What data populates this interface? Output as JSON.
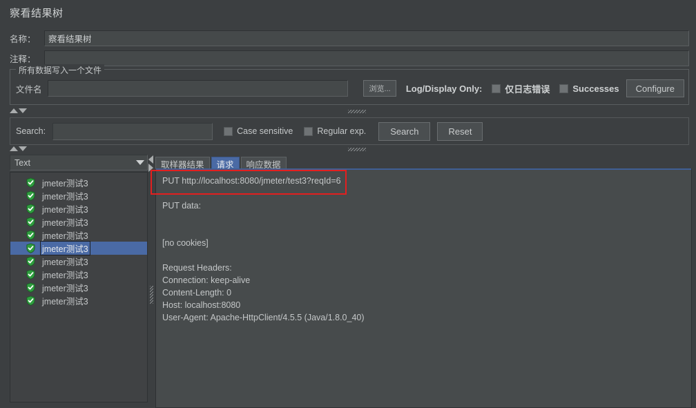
{
  "window": {
    "title": "察看结果树"
  },
  "form": {
    "name_label": "名称：",
    "name_value": "察看结果树",
    "comment_label": "注释：",
    "comment_value": ""
  },
  "file_group": {
    "legend": "所有数据写入一个文件",
    "filename_label": "文件名",
    "filename_value": "",
    "browse_label": "浏览...",
    "log_display_only_label": "Log/Display Only:",
    "errors_only_label": "仅日志错误",
    "errors_only_checked": false,
    "successes_label": "Successes",
    "successes_checked": false,
    "configure_label": "Configure"
  },
  "search": {
    "label": "Search:",
    "value": "",
    "case_sensitive_label": "Case sensitive",
    "case_sensitive_checked": false,
    "regular_exp_label": "Regular exp.",
    "regular_exp_checked": false,
    "search_button": "Search",
    "reset_button": "Reset"
  },
  "results": {
    "renderer_selected": "Text",
    "tree_items": [
      {
        "label": "jmeter测试3",
        "status": "success",
        "selected": false
      },
      {
        "label": "jmeter测试3",
        "status": "success",
        "selected": false
      },
      {
        "label": "jmeter测试3",
        "status": "success",
        "selected": false
      },
      {
        "label": "jmeter测试3",
        "status": "success",
        "selected": false
      },
      {
        "label": "jmeter测试3",
        "status": "success",
        "selected": false
      },
      {
        "label": "jmeter测试3",
        "status": "success",
        "selected": true
      },
      {
        "label": "jmeter测试3",
        "status": "success",
        "selected": false
      },
      {
        "label": "jmeter测试3",
        "status": "success",
        "selected": false
      },
      {
        "label": "jmeter测试3",
        "status": "success",
        "selected": false
      },
      {
        "label": "jmeter测试3",
        "status": "success",
        "selected": false
      }
    ],
    "tabs": [
      {
        "label": "取样器结果",
        "active": false
      },
      {
        "label": "请求",
        "active": true
      },
      {
        "label": "响应数据",
        "active": false
      }
    ],
    "request_text": "PUT http://localhost:8080/jmeter/test3?reqId=6\n\nPUT data:\n\n\n[no cookies]\n\nRequest Headers:\nConnection: keep-alive\nContent-Length: 0\nHost: localhost:8080\nUser-Agent: Apache-HttpClient/4.5.5 (Java/1.8.0_40)"
  },
  "annotation": {
    "highlight_color": "#e41f1f",
    "highlighted_line": "PUT http://localhost:8080/jmeter/test3?reqId=6"
  },
  "colors": {
    "window_bg": "#3c3f41",
    "panel_bg": "#474b4c",
    "tree_bg": "#404244",
    "selection_blue": "#4a6aa5",
    "success_green": "#2f9e3f",
    "text": "#c4c7c8"
  }
}
